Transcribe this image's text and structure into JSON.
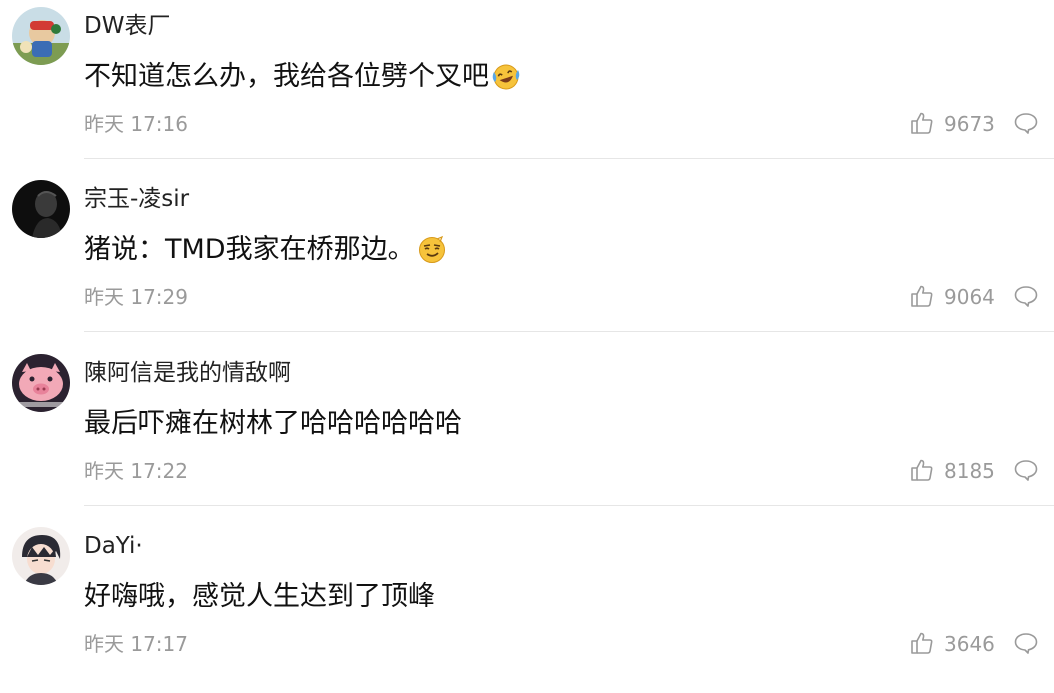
{
  "comments": [
    {
      "username": "DW表厂",
      "text": "不知道怎么办，我给各位劈个叉吧",
      "emoji": "laughing-crying-emoji",
      "time": "昨天 17:16",
      "likes": "9673"
    },
    {
      "username": "宗玉-凌sir",
      "text": "猪说：TMD我家在桥那边。",
      "emoji": "smug-emoji",
      "time": "昨天 17:29",
      "likes": "9064"
    },
    {
      "username": "陳阿信是我的情敌啊",
      "text": "最后吓瘫在树林了哈哈哈哈哈哈",
      "time": "昨天 17:22",
      "likes": "8185"
    },
    {
      "username": "DaYi·",
      "text": "好嗨哦，感觉人生达到了顶峰",
      "time": "昨天 17:17",
      "likes": "3646"
    }
  ],
  "icons": {
    "like": "thumbs-up-icon",
    "reply": "comment-bubble-icon"
  },
  "colors": {
    "meta_text": "#9a9a9a",
    "username": "#222222",
    "divider": "#e6e6e6"
  }
}
